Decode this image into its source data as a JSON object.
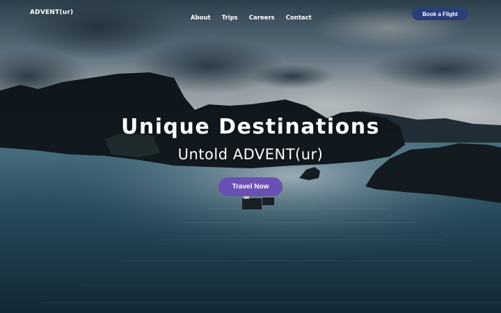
{
  "brand": {
    "name": "ADVENT(ur)"
  },
  "nav": {
    "links": [
      {
        "label": "About"
      },
      {
        "label": "Trips"
      },
      {
        "label": "Careers"
      },
      {
        "label": "Contact"
      }
    ],
    "book_button": "Book a Flight"
  },
  "hero": {
    "title": "Unique Destinations",
    "subtitle": "Untold ADVENT(ur)",
    "cta_label": "Travel Now",
    "background": "dusk-bay-with-limestone-islands-and-boats"
  },
  "colors": {
    "book_button_bg": "#2a3e7a",
    "cta_bg": "#6a4fb4",
    "text": "#ffffff"
  }
}
